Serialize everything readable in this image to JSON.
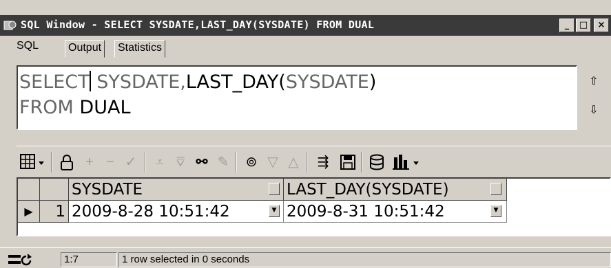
{
  "window": {
    "title": "SQL Window - SELECT SYSDATE,LAST_DAY(SYSDATE) FROM DUAL",
    "minimize": "_",
    "maximize": "□",
    "close": "×"
  },
  "tabs": [
    {
      "label": "SQL",
      "active": true
    },
    {
      "label": "Output",
      "active": false
    },
    {
      "label": "Statistics",
      "active": false
    }
  ],
  "editor": {
    "line1": {
      "kw1": "SELECT",
      "rest": " SYSDATE,",
      "fn": "LAST_DAY(",
      "arg": "SYSDATE",
      "close": ")"
    },
    "line2": {
      "kw": "FROM",
      "table": " DUAL"
    },
    "scroll_up": "⇧",
    "scroll_down": "⇩"
  },
  "toolbar": {
    "icons": [
      "grid-menu-icon",
      "lock-icon",
      "add-record-icon",
      "delete-record-icon",
      "post-record-icon",
      "filter-icon",
      "clear-filter-icon",
      "find-icon",
      "clear-find-icon",
      "query-by-example-icon",
      "next-page-icon",
      "previous-page-icon",
      "export-icon",
      "save-icon",
      "database-icon",
      "chart-icon"
    ]
  },
  "grid": {
    "columns": [
      "SYSDATE",
      "LAST_DAY(SYSDATE)"
    ],
    "rows": [
      {
        "num": "1",
        "values": [
          "2009-8-28 10:51:42",
          "2009-8-31 10:51:42"
        ]
      }
    ]
  },
  "status": {
    "position": "1:7",
    "message": "1 row selected in 0 seconds"
  }
}
